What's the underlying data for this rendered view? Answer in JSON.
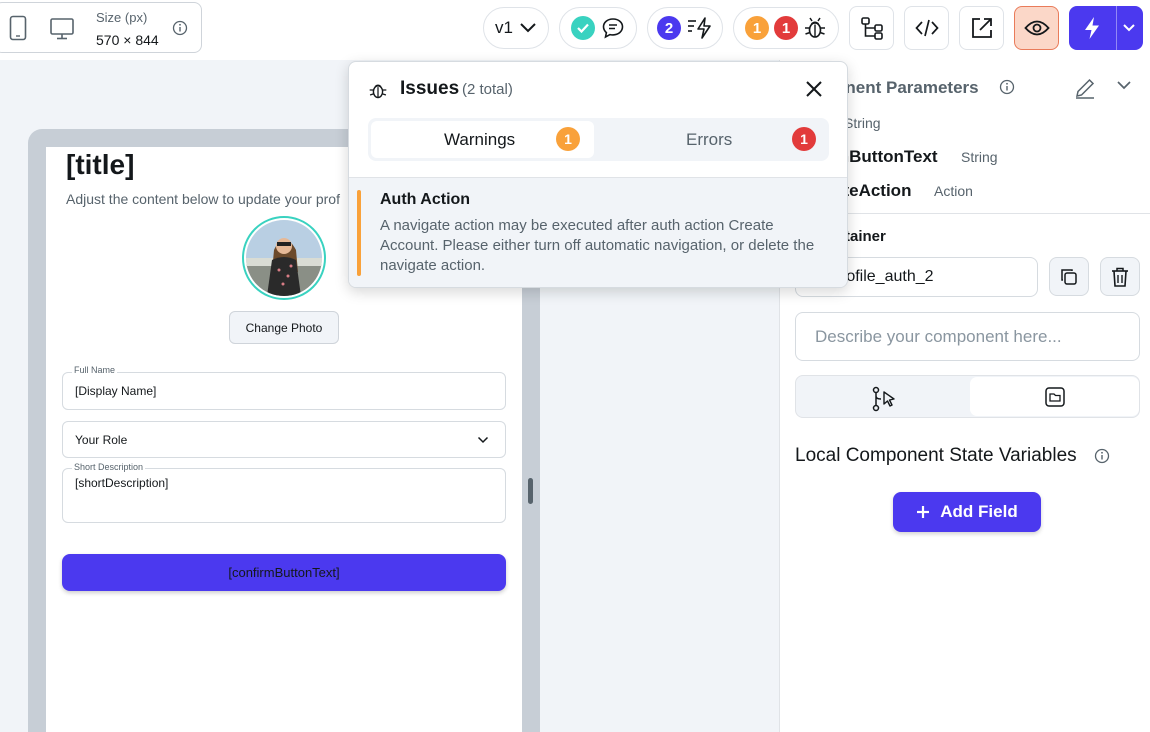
{
  "toolbar": {
    "size_label": "Size (px)",
    "size_value": "570 × 844",
    "version": "v1",
    "agent_badge_count": "2",
    "warnings_count": "1",
    "errors_count": "1"
  },
  "colors": {
    "primary": "#4b39ef",
    "warning": "#f9a13a",
    "error": "#e23b3b",
    "success": "#39d2c0"
  },
  "preview": {
    "title": "[title]",
    "subtitle": "Adjust the content below to update your prof",
    "change_photo": "Change Photo",
    "full_name_label": "Full Name",
    "full_name_value": "[Display Name]",
    "role_value": "Your Role",
    "short_desc_label": "Short Description",
    "short_desc_value": "[shortDescription]",
    "confirm_button": "[confirmButtonText]"
  },
  "issues": {
    "title": "Issues",
    "total": "(2 total)",
    "tab_warnings": "Warnings",
    "tab_errors": "Errors",
    "warnings_count": "1",
    "errors_count": "1",
    "item_title": "Auth Action",
    "item_text": "A navigate action may be executed after auth action Create Account. Please either turn off automatic navigation, or delete the navigate action."
  },
  "right_panel": {
    "params_title": "onent Parameters",
    "param1_type": "String",
    "param2_name": "mButtonText",
    "param2_type": "String",
    "param3_name": "ateAction",
    "param3_type": "Action",
    "container_label": "tainer",
    "component_name": "rofile_auth_2",
    "describe_placeholder": "Describe your component here...",
    "state_vars_title": "Local Component State Variables",
    "add_field": "Add Field"
  }
}
